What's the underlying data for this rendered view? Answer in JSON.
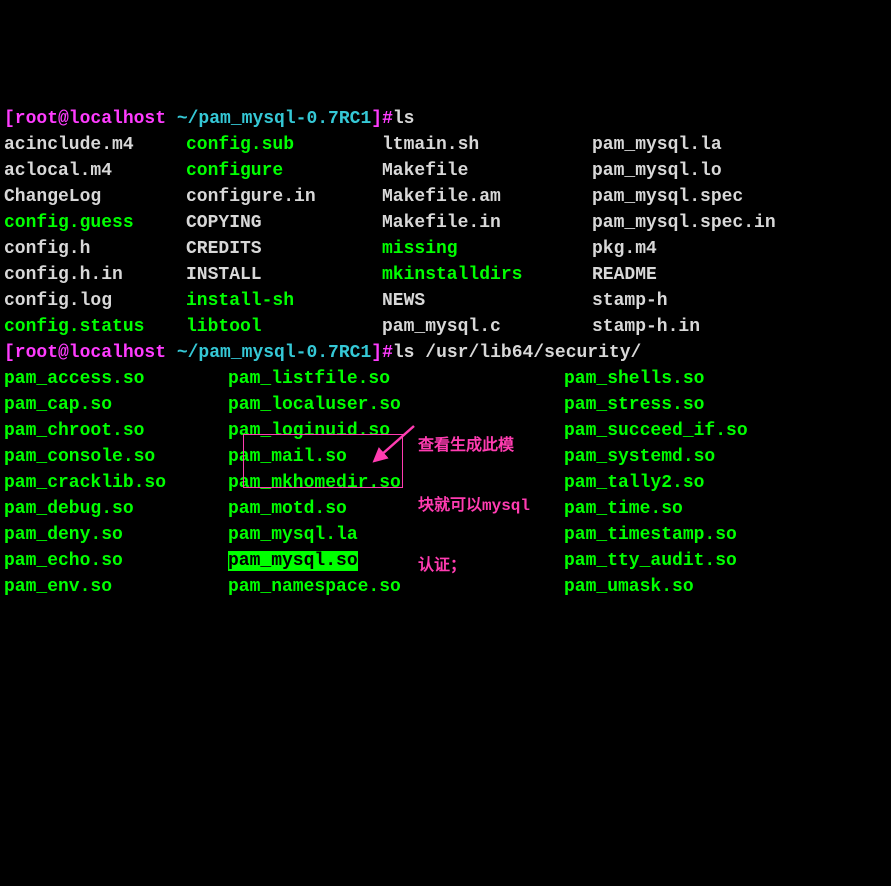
{
  "prompt1": {
    "user": "[root@localhost ",
    "path": "~/pam_mysql-0.7RC1",
    "end": "]#",
    "cmd": "ls"
  },
  "ls1": [
    [
      "acinclude.m4",
      "config.sub",
      "ltmain.sh",
      "pam_mysql.la"
    ],
    [
      "aclocal.m4",
      "configure",
      "Makefile",
      "pam_mysql.lo"
    ],
    [
      "ChangeLog",
      "configure.in",
      "Makefile.am",
      "pam_mysql.spec"
    ],
    [
      "config.guess",
      "COPYING",
      "Makefile.in",
      "pam_mysql.spec.in"
    ],
    [
      "config.h",
      "CREDITS",
      "missing",
      "pkg.m4"
    ],
    [
      "config.h.in",
      "INSTALL",
      "mkinstalldirs",
      "README"
    ],
    [
      "config.log",
      "install-sh",
      "NEWS",
      "stamp-h"
    ],
    [
      "config.status",
      "libtool",
      "pam_mysql.c",
      "stamp-h.in"
    ]
  ],
  "ls1_green": [
    "config.sub",
    "configure",
    "config.guess",
    "missing",
    "mkinstalldirs",
    "install-sh",
    "config.status",
    "libtool"
  ],
  "prompt2": {
    "user": "[root@localhost ",
    "path": "~/pam_mysql-0.7RC1",
    "end": "]#",
    "cmd": "ls /usr/lib64/security/"
  },
  "ls2": [
    [
      "pam_access.so",
      "pam_listfile.so",
      "pam_shells.so"
    ],
    [
      "pam_cap.so",
      "pam_localuser.so",
      "pam_stress.so"
    ],
    [
      "pam_chroot.so",
      "pam_loginuid.so",
      "pam_succeed_if.so"
    ],
    [
      "pam_console.so",
      "pam_mail.so",
      "pam_systemd.so"
    ],
    [
      "pam_cracklib.so",
      "pam_mkhomedir.so",
      "pam_tally2.so"
    ],
    [
      "pam_debug.so",
      "pam_motd.so",
      "pam_time.so"
    ],
    [
      "pam_deny.so",
      "pam_mysql.la",
      "pam_timestamp.so"
    ],
    [
      "pam_echo.so",
      "pam_mysql.so",
      "pam_tty_audit.so"
    ],
    [
      "pam_env.so",
      "pam_namespace.so",
      "pam_umask.so"
    ]
  ],
  "annotation": {
    "l1": "查看生成此模",
    "l2": "块就可以mysql",
    "l3": "认证；"
  },
  "cols1": [
    0,
    182,
    378,
    588
  ],
  "cols2": [
    0,
    224,
    560
  ]
}
